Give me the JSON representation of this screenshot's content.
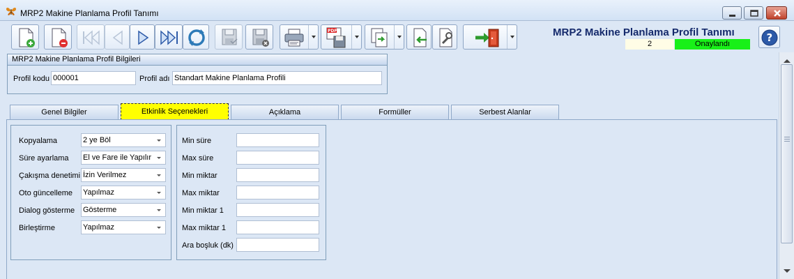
{
  "window": {
    "title": "MRP2 Makine Planlama Profil Tanımı",
    "app_icon": "butterfly-icon",
    "controls": [
      "minimize-icon",
      "maximize-icon",
      "close-icon"
    ]
  },
  "toolbar": {
    "buttons": [
      {
        "name": "new-record-button",
        "icon": "new-document-icon"
      },
      {
        "name": "delete-record-button",
        "icon": "delete-document-icon"
      },
      {
        "name": "first-record-button",
        "icon": "first-icon"
      },
      {
        "name": "previous-record-button",
        "icon": "previous-icon"
      },
      {
        "name": "next-record-button",
        "icon": "next-icon"
      },
      {
        "name": "last-record-button",
        "icon": "last-icon"
      },
      {
        "name": "refresh-button",
        "icon": "refresh-icon"
      },
      {
        "name": "save-button",
        "icon": "save-icon"
      },
      {
        "name": "cancel-save-button",
        "icon": "cancel-save-icon"
      },
      {
        "name": "print-button",
        "icon": "printer-icon"
      },
      {
        "name": "pdf-export-button",
        "icon": "pdf-save-icon"
      },
      {
        "name": "copy-button",
        "icon": "copy-icon"
      },
      {
        "name": "import-button",
        "icon": "import-icon"
      },
      {
        "name": "tools-button",
        "icon": "wrench-icon"
      },
      {
        "name": "exit-button",
        "icon": "exit-door-icon"
      }
    ]
  },
  "header": {
    "title": "MRP2 Makine Planlama Profil Tanımı",
    "record_number": "2",
    "status": "Onaylandı",
    "status_color": "#18f018"
  },
  "profile_group": {
    "title": "MRP2 Makine Planlama Profil Bilgileri",
    "code_label": "Profil kodu",
    "code_value": "000001",
    "name_label": "Profil adı",
    "name_value": "Standart Makine Planlama Profili"
  },
  "tabs": [
    {
      "label": "Genel Bilgiler"
    },
    {
      "label": "Etkinlik Seçenekleri"
    },
    {
      "label": "Açıklama"
    },
    {
      "label": "Formüller"
    },
    {
      "label": "Serbest Alanlar"
    }
  ],
  "active_tab": "Etkinlik Seçenekleri",
  "options_panel": {
    "rows": [
      {
        "label": "Kopyalama",
        "value": "2 ye Böl"
      },
      {
        "label": "Süre ayarlama",
        "value": "El ve Fare ile Yapılır"
      },
      {
        "label": "Çakışma denetimi",
        "value": "İzin Verilmez"
      },
      {
        "label": "Oto güncelleme",
        "value": "Yapılmaz"
      },
      {
        "label": "Dialog gösterme",
        "value": "Gösterme"
      },
      {
        "label": "Birleştirme",
        "value": "Yapılmaz"
      }
    ]
  },
  "limits_panel": {
    "rows": [
      {
        "label": "Min süre",
        "value": ""
      },
      {
        "label": "Max süre",
        "value": ""
      },
      {
        "label": "Min miktar",
        "value": ""
      },
      {
        "label": "Max miktar",
        "value": ""
      },
      {
        "label": "Min miktar 1",
        "value": ""
      },
      {
        "label": "Max miktar 1",
        "value": ""
      },
      {
        "label": "Ara boşluk (dk)",
        "value": ""
      }
    ]
  }
}
